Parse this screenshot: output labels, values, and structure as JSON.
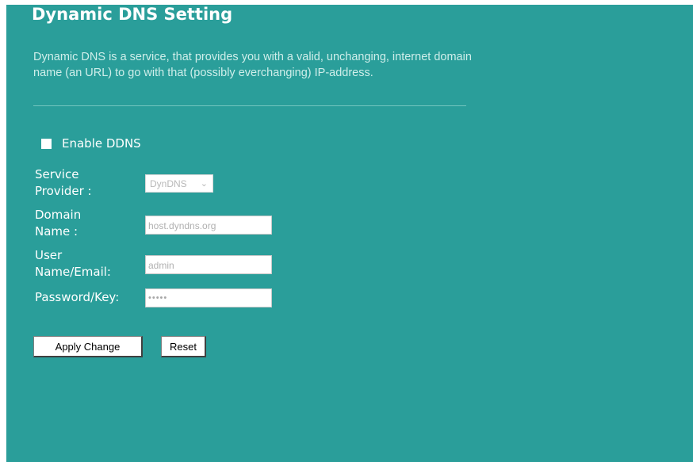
{
  "page": {
    "title": "Dynamic DNS  Setting",
    "description": "Dynamic DNS is a service, that provides you with a valid, unchanging, internet domain name (an URL) to go with that (possibly everchanging) IP-address."
  },
  "enable": {
    "label": "Enable DDNS",
    "checked": false
  },
  "form": {
    "provider": {
      "label_line1": "Service",
      "label_line2": "Provider :",
      "value": "DynDNS"
    },
    "domain": {
      "label_line1": "Domain",
      "label_line2": "Name :",
      "value": "host.dyndns.org"
    },
    "user": {
      "label_line1": "User",
      "label_line2": "Name/Email:",
      "value": "admin"
    },
    "password": {
      "label": "Password/Key:",
      "value": "•••••"
    }
  },
  "buttons": {
    "apply": "Apply Change",
    "reset": "Reset"
  },
  "colors": {
    "background": "#2a9e9a",
    "text": "#ffffff",
    "description_text": "#cfeeea"
  },
  "icons": {
    "select_chevron": "chevron-down-icon"
  }
}
